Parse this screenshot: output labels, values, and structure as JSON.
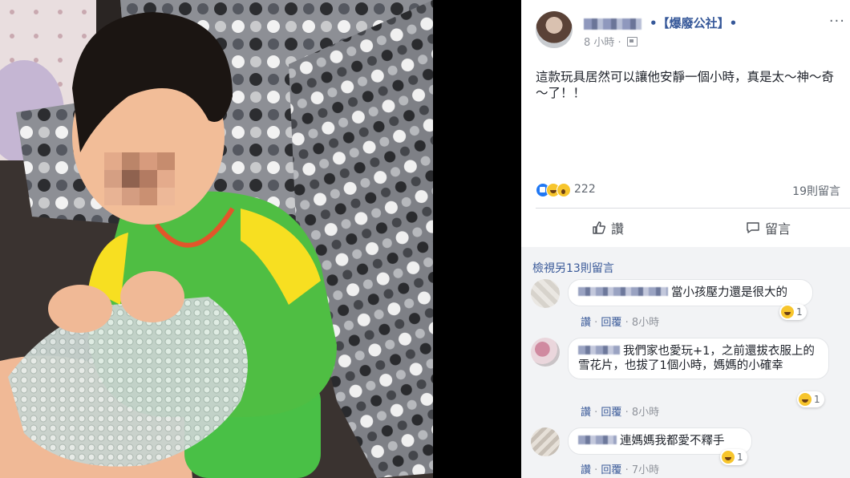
{
  "post": {
    "author_tag": "•【爆廢公社】•",
    "time": "8 小時 ·",
    "privacy_icon": "group-icon",
    "more": "···",
    "text": "這款玩具居然可以讓他安靜一個小時，真是太～神～奇～了！！",
    "reaction_icons": [
      "like-icon",
      "haha-icon",
      "wow-icon"
    ],
    "reaction_count": "222",
    "comment_count": "19則留言"
  },
  "actions": {
    "like_label": "讚",
    "comment_label": "留言"
  },
  "comments": {
    "view_more": "檢視另13則留言",
    "items": [
      {
        "text": "當小孩壓力還是很大的",
        "reactions": "1",
        "like": "讚",
        "reply": "回覆",
        "time": "8小時"
      },
      {
        "text": "我們家也愛玩+1，之前還拔衣服上的雪花片，也拔了1個小時，媽媽的小確幸",
        "reactions": "1",
        "like": "讚",
        "reply": "回覆",
        "time": "8小時"
      },
      {
        "text": "連媽媽我都愛不釋手",
        "reactions": "1",
        "like": "讚",
        "reply": "回覆",
        "time": "7小時"
      }
    ]
  }
}
